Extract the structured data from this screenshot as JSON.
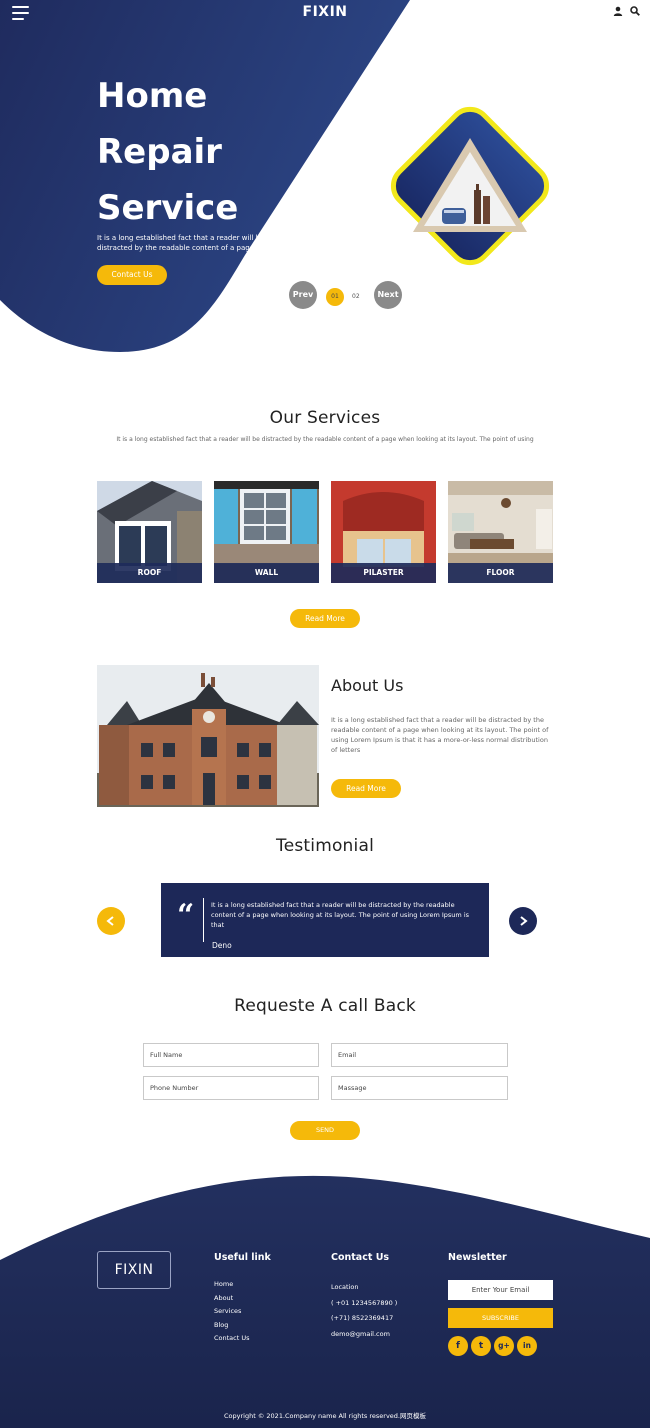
{
  "colors": {
    "navy": "#1d2858",
    "navy_light": "#2d4a8c",
    "accent": "#f5b90a",
    "gray_button": "#8a8a8a"
  },
  "header": {
    "logo": "FIXIN",
    "icons": [
      "menu-icon",
      "user-icon",
      "search-icon"
    ]
  },
  "hero": {
    "title_line1": "Home",
    "title_line2": "Repair",
    "title_line3": "Service",
    "text": "It is a long established fact that a reader will be distracted by the readable content of a page",
    "button": "Contact Us",
    "pager": {
      "prev": "Prev",
      "current": "01",
      "next_num": "02",
      "next": "Next"
    }
  },
  "services": {
    "title": "Our Services",
    "subtitle": "It is a long established fact that a reader will be distracted by the readable content of a page when looking at its layout. The point of using",
    "cards": [
      {
        "label": "ROOF"
      },
      {
        "label": "WALL"
      },
      {
        "label": "PILASTER"
      },
      {
        "label": "FLOOR"
      }
    ],
    "button": "Read More"
  },
  "about": {
    "title": "About Us",
    "text": "It is a long established fact that a reader will be distracted by the readable content of a page when looking at its layout. The point of using Lorem Ipsum is that it has a more-or-less normal distribution of letters",
    "button": "Read More"
  },
  "testimonial": {
    "title": "Testimonial",
    "text": "It is a long established fact that a reader will be distracted by the readable content of a page when looking at its layout. The point of using Lorem Ipsum is that",
    "name": "Deno"
  },
  "callback": {
    "title": "Requeste A call Back",
    "full_name_placeholder": "Full Name",
    "email_placeholder": "Email",
    "phone_placeholder": "Phone Number",
    "message_placeholder": "Massage",
    "button": "SEND"
  },
  "footer": {
    "logo": "FIXIN",
    "useful_title": "Useful link",
    "links": [
      "Home",
      "About",
      "Services",
      "Blog",
      "Contact Us"
    ],
    "contact_title": "Contact Us",
    "contact": [
      "Location",
      "( +01 1234567890 )",
      "(+71) 8522369417",
      "demo@gmail.com"
    ],
    "newsletter_title": "Newsletter",
    "email_placeholder": "Enter Your Email",
    "subscribe": "SUBSCRIBE",
    "social": [
      "f",
      "t",
      "g+",
      "in"
    ],
    "copyright": "Copyright © 2021.Company name All rights reserved.网页模板"
  }
}
